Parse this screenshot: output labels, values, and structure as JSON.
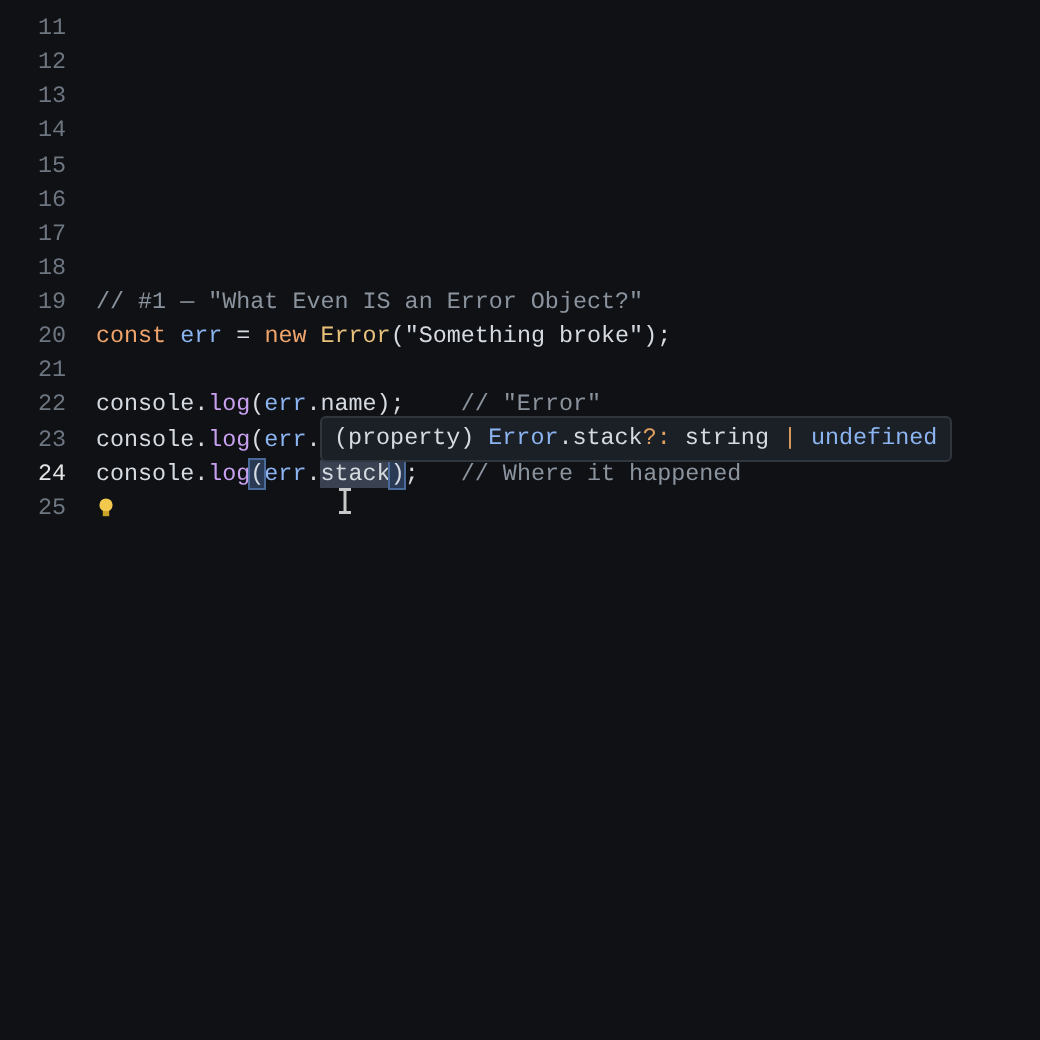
{
  "editor": {
    "lines": [
      {
        "number": "11",
        "active": false
      },
      {
        "number": "12",
        "active": false
      },
      {
        "number": "13",
        "active": false
      },
      {
        "number": "14",
        "active": false
      },
      {
        "number": "15",
        "active": false
      },
      {
        "number": "16",
        "active": false
      },
      {
        "number": "17",
        "active": false
      },
      {
        "number": "18",
        "active": false
      },
      {
        "number": "19",
        "active": false,
        "tokens": [
          {
            "text": "// #1 — \"What Even IS an Error Object?\"",
            "kind": "comment"
          }
        ]
      },
      {
        "number": "20",
        "active": false,
        "tokens": [
          {
            "text": "const",
            "kind": "keyword"
          },
          {
            "text": " err",
            "kind": "variable"
          },
          {
            "text": " = ",
            "kind": "plain"
          },
          {
            "text": "new",
            "kind": "keyword"
          },
          {
            "text": " Error",
            "kind": "type"
          },
          {
            "text": "(\"Something broke\");",
            "kind": "plain"
          }
        ]
      },
      {
        "number": "21",
        "active": false
      },
      {
        "number": "22",
        "active": false,
        "tokens": [
          {
            "text": "console.",
            "kind": "plain"
          },
          {
            "text": "log",
            "kind": "function"
          },
          {
            "text": "(",
            "kind": "plain"
          },
          {
            "text": "err",
            "kind": "variable"
          },
          {
            "text": ".name);    ",
            "kind": "plain"
          },
          {
            "text": "// \"Error\"",
            "kind": "comment"
          }
        ]
      },
      {
        "number": "23",
        "active": false,
        "tokens": [
          {
            "text": "console.",
            "kind": "plain"
          },
          {
            "text": "log",
            "kind": "function"
          },
          {
            "text": "(",
            "kind": "plain"
          },
          {
            "text": "err",
            "kind": "variable"
          },
          {
            "text": ".",
            "kind": "plain"
          }
        ]
      },
      {
        "number": "24",
        "active": true,
        "tokens": [
          {
            "text": "console.",
            "kind": "plain"
          },
          {
            "text": "log",
            "kind": "function"
          },
          {
            "text": "(",
            "kind": "bracket-match"
          },
          {
            "text": "err",
            "kind": "variable"
          },
          {
            "text": ".",
            "kind": "plain"
          },
          {
            "text": "stack",
            "kind": "word-highlight"
          },
          {
            "text": ")",
            "kind": "bracket-match"
          },
          {
            "text": ";   ",
            "kind": "plain"
          },
          {
            "text": "// Where it happened",
            "kind": "comment"
          }
        ]
      },
      {
        "number": "25",
        "active": false,
        "lightbulb": true
      }
    ]
  },
  "hover": {
    "tokens": [
      {
        "text": "(property) ",
        "kind": "plain"
      },
      {
        "text": "Error",
        "kind": "variable"
      },
      {
        "text": ".stack",
        "kind": "plain"
      },
      {
        "text": "?:",
        "kind": "operator"
      },
      {
        "text": " string ",
        "kind": "plain"
      },
      {
        "text": "|",
        "kind": "operator"
      },
      {
        "text": " undefined",
        "kind": "variable"
      }
    ]
  }
}
